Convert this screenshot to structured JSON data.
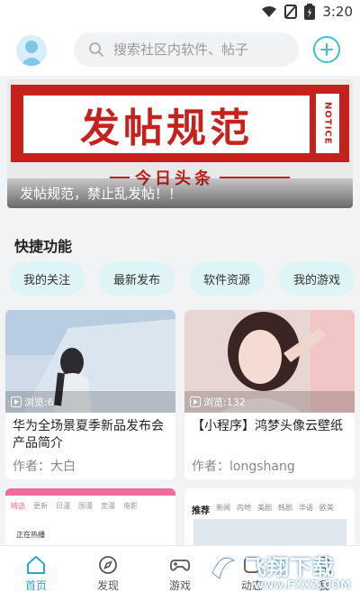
{
  "status_bar": {
    "time": "3:20"
  },
  "header": {
    "search_placeholder": "搜索社区内软件、帖子"
  },
  "banner": {
    "title": "发帖规范",
    "notice": "NOTICE",
    "headline": "今日头条",
    "caption": "发帖规范，禁止乱发帖！！"
  },
  "quick": {
    "title": "快捷功能",
    "chips": [
      "我的关注",
      "最新发布",
      "软件资源",
      "我的游戏"
    ]
  },
  "cards": [
    {
      "views": "浏览:6",
      "title": "华为全场景夏季新品发布会产品简介",
      "author": "作者：大白"
    },
    {
      "views": "浏览:132",
      "title": "【小程序】鸿梦头像云壁纸",
      "author": "作者：longshang"
    }
  ],
  "mini_cards": {
    "left_tabs": [
      "精选",
      "更新",
      "日漫",
      "国漫",
      "竞漫",
      "电影"
    ],
    "left_hot": "正在热播",
    "right_tabs": [
      "推荐",
      "新闻",
      "内地",
      "美剧",
      "韩剧",
      "华语",
      "欧美"
    ]
  },
  "tabbar": {
    "items": [
      {
        "label": "首页",
        "icon": "home-icon"
      },
      {
        "label": "发现",
        "icon": "compass-icon"
      },
      {
        "label": "游戏",
        "icon": "gamepad-icon"
      },
      {
        "label": "动态",
        "icon": "activity-icon"
      },
      {
        "label": "我",
        "icon": "user-icon"
      }
    ]
  },
  "watermark": {
    "text": "飞翔下载",
    "url": "www.FXXZ.COM"
  },
  "colors": {
    "accent": "#3bc3c5",
    "active_tab": "#2aa8c7",
    "banner_red": "#c5211d",
    "chip_bg": "#dff4f4"
  }
}
